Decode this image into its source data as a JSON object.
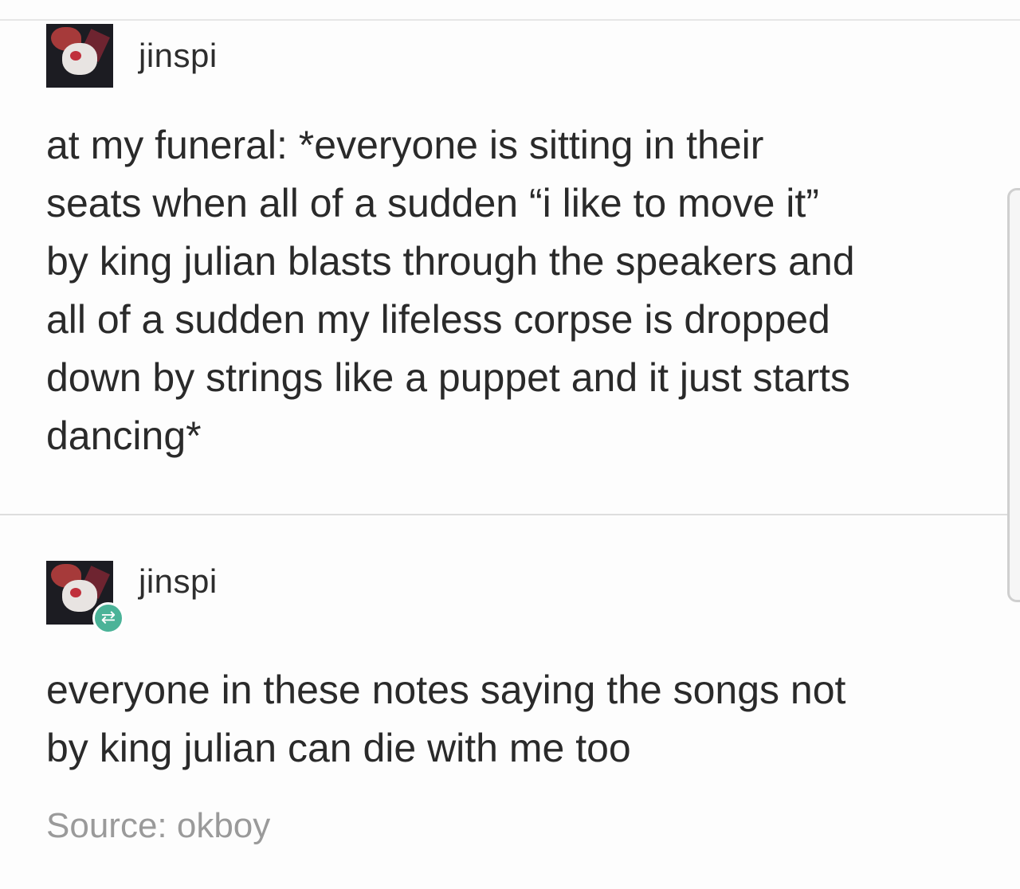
{
  "post1": {
    "username": "jinspi",
    "avatar_icon": "avatar-image",
    "text_lines": [
      "at my funeral: *everyone is sitting in their",
      "seats when all of a sudden “i like to move it”",
      "by king julian blasts through the speakers and",
      "all of a sudden my lifeless corpse is dropped",
      "down by strings like a puppet and it just starts",
      "dancing*"
    ]
  },
  "post2": {
    "username": "jinspi",
    "avatar_icon": "avatar-image",
    "badge_icon": "reblog-icon",
    "badge_color": "#4bb398",
    "text_lines": [
      "everyone in these notes saying the songs not",
      "by king julian can die with me too"
    ]
  },
  "source": {
    "text": "Source: okboy"
  }
}
